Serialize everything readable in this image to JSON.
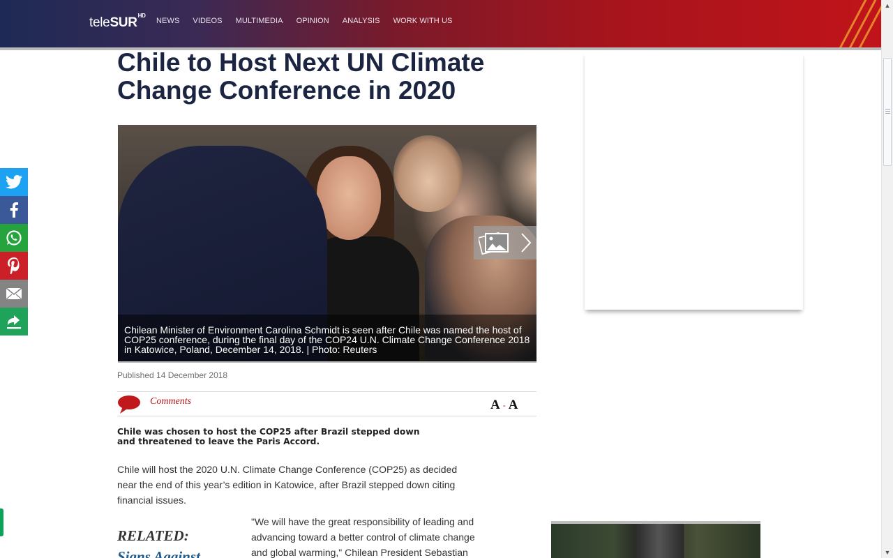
{
  "header": {
    "logo_text": "tele",
    "logo_bold": "SUR",
    "logo_badge": "HD",
    "nav": [
      "NEWS",
      "VIDEOS",
      "MULTIMEDIA",
      "OPINION",
      "ANALYSIS",
      "WORK WITH US"
    ]
  },
  "share_bar": [
    {
      "name": "twitter",
      "color": "#1da1f2"
    },
    {
      "name": "facebook",
      "color": "#3b5998"
    },
    {
      "name": "whatsapp",
      "color": "#25a33d"
    },
    {
      "name": "pinterest",
      "color": "#cb2027"
    },
    {
      "name": "email",
      "color": "#848484"
    },
    {
      "name": "more",
      "color": "#1fa35a"
    }
  ],
  "article": {
    "headline": "Chile to Host Next UN Climate Change Conference in 2020",
    "image_caption": "Chilean Minister of Environment Carolina Schmidt is seen after Chile was named the host of COP25 conference, during the final day of the COP24 U.N. Climate Change Conference 2018 in Katowice, Poland, December 14, 2018. | Photo: Reuters",
    "published": "Published 14 December 2018",
    "comments_label": "Comments",
    "font_increase": "A",
    "font_separator": "-",
    "font_decrease": "A",
    "lead": "Chile was chosen to host the COP25 after Brazil stepped down and threatened to leave the Paris Accord.",
    "paragraph_1": "Chile will host the 2020 U.N. Climate Change Conference (COP25) as decided near the end of this year’s edition in Katowice, after Brazil stepped down citing financial issues.",
    "related_label": "RELATED:",
    "related_link": "Signs Against",
    "quote": "\"We will have the great responsibility of leading and advancing toward a better control of climate change and global warming,\" Chilean President Sebastian"
  },
  "colors": {
    "headline": "#1b2440",
    "comments": "#b51212",
    "related_link": "#1c5a8c"
  }
}
